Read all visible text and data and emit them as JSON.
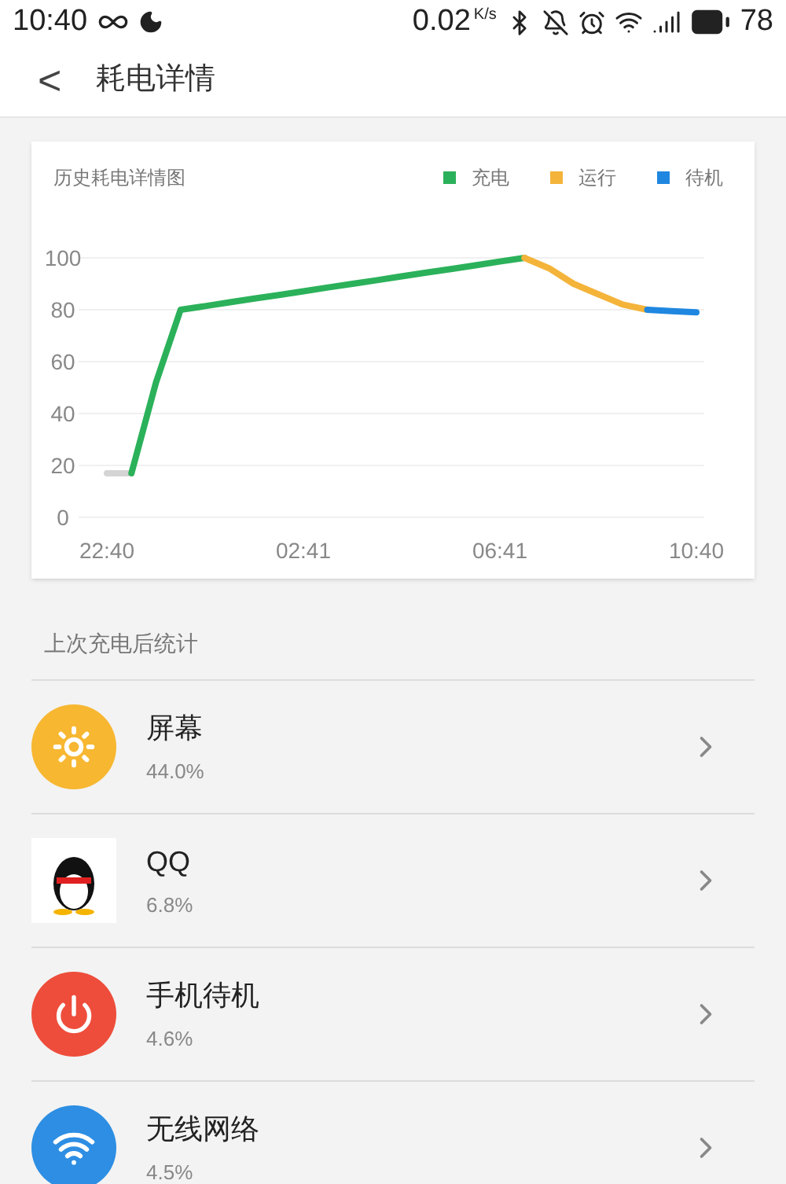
{
  "status_bar": {
    "time": "10:40",
    "speed": "0.02",
    "speed_unit": "K/s",
    "battery": "78"
  },
  "header": {
    "back": "<",
    "title": "耗电详情"
  },
  "chart_card": {
    "title": "历史耗电详情图",
    "chart_data": {
      "type": "line",
      "grid": true,
      "categories": [
        "22:40",
        null,
        null,
        null,
        null,
        null,
        null,
        null,
        "02:41",
        null,
        null,
        null,
        null,
        null,
        null,
        null,
        "06:41",
        null,
        null,
        null,
        null,
        null,
        null,
        null,
        "10:40"
      ],
      "ylim": [
        0,
        100
      ],
      "yticks": [
        0,
        20,
        40,
        60,
        80,
        100
      ],
      "series": [
        {
          "color": "#d4d4d4",
          "values": [
            17,
            17,
            null,
            null,
            null,
            null,
            null,
            null,
            null,
            null,
            null,
            null,
            null,
            null,
            null,
            null,
            null,
            null,
            null,
            null,
            null,
            null,
            null,
            null,
            null
          ]
        },
        {
          "name": "充电",
          "color": "#2bb15a",
          "values": [
            null,
            17,
            52,
            80,
            81.4,
            82.9,
            84.3,
            85.7,
            87.1,
            88.6,
            90,
            91.4,
            92.9,
            94.3,
            95.7,
            97.1,
            98.6,
            100,
            null,
            null,
            null,
            null,
            null,
            null,
            null
          ]
        },
        {
          "name": "运行",
          "color": "#f4b43a",
          "values": [
            null,
            null,
            null,
            null,
            null,
            null,
            null,
            null,
            null,
            null,
            null,
            null,
            null,
            null,
            null,
            null,
            null,
            100,
            96,
            90,
            86,
            82,
            80,
            null,
            null
          ]
        },
        {
          "name": "待机",
          "color": "#1f87e0",
          "values": [
            null,
            null,
            null,
            null,
            null,
            null,
            null,
            null,
            null,
            null,
            null,
            null,
            null,
            null,
            null,
            null,
            null,
            null,
            null,
            null,
            null,
            null,
            80,
            79.5,
            79
          ]
        }
      ]
    }
  },
  "section_title": "上次充电后统计",
  "apps": [
    {
      "kind": "sun",
      "name": "屏幕",
      "percent": "44.0%",
      "color": "#f7b731"
    },
    {
      "kind": "penguin",
      "name": "QQ",
      "percent": "6.8%",
      "color": "#ffffff"
    },
    {
      "kind": "power",
      "name": "手机待机",
      "percent": "4.6%",
      "color": "#ee4d3b"
    },
    {
      "kind": "wifi",
      "name": "无线网络",
      "percent": "4.5%",
      "color": "#2d8ee3"
    }
  ]
}
